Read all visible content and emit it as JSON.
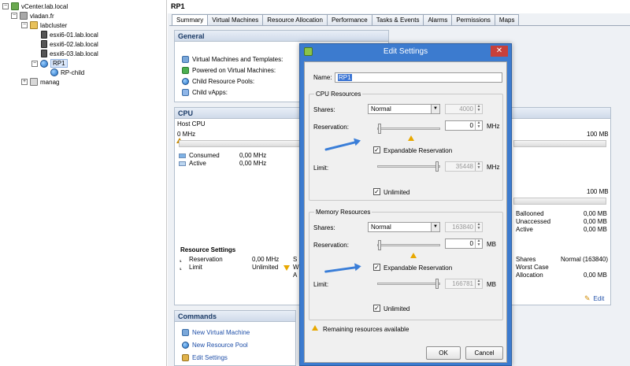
{
  "tree": {
    "root": "vCenter.lab.local",
    "datacenter": "vladan.fr",
    "cluster": "labcluster",
    "hosts": [
      "esxi6-01.lab.local",
      "esxi6-02.lab.local",
      "esxi6-03.lab.local"
    ],
    "resource_pool": "RP1",
    "child_pool": "RP-child",
    "other": "manag"
  },
  "right": {
    "title": "RP1",
    "tabs": [
      "Summary",
      "Virtual Machines",
      "Resource Allocation",
      "Performance",
      "Tasks & Events",
      "Alarms",
      "Permissions",
      "Maps"
    ],
    "general": {
      "header": "General",
      "rows": [
        "Virtual Machines and Templates:",
        "Powered on Virtual Machines:",
        "Child Resource Pools:",
        "Child vApps:"
      ]
    },
    "cpu": {
      "header": "CPU",
      "host_label": "Host CPU",
      "min": "0 MHz",
      "max1": "100 MB",
      "max2": "100 MB",
      "consumed_label": "Consumed",
      "consumed_value": "0,00 MHz",
      "active_label": "Active",
      "active_value": "0,00 MHz"
    },
    "memory_right": {
      "ballooned_label": "Ballooned",
      "ballooned_value": "0,00 MB",
      "unaccessed_label": "Unaccessed",
      "unaccessed_value": "0,00 MB",
      "active_label": "Active",
      "active_value": "0,00 MB",
      "shares_label": "Shares",
      "shares_value": "Normal (163840)",
      "worst_label": "Worst Case",
      "allocation_label": "Allocation",
      "allocation_value": "0,00 MB",
      "edit_label": "Edit"
    },
    "resource_settings": {
      "header": "Resource Settings",
      "reservation_label": "Reservation",
      "reservation_value": "0,00 MHz",
      "limit_label": "Limit",
      "limit_value": "Unlimited",
      "partial1": "S",
      "partial2": "W",
      "partial3": "A"
    },
    "commands": {
      "header": "Commands",
      "items": [
        "New Virtual Machine",
        "New Resource Pool",
        "Edit Settings"
      ]
    }
  },
  "dialog": {
    "title": "Edit Settings",
    "close": "✕",
    "name_label": "Name:",
    "name_value": "RP1",
    "cpu": {
      "group": "CPU Resources",
      "shares_label": "Shares:",
      "shares_value": "Normal",
      "shares_number": "4000",
      "reservation_label": "Reservation:",
      "reservation_value": "0",
      "reservation_unit": "MHz",
      "expandable_label": "Expandable Reservation",
      "expandable_checked": true,
      "limit_label": "Limit:",
      "limit_value": "35448",
      "limit_unit": "MHz",
      "unlimited_label": "Unlimited",
      "unlimited_checked": true
    },
    "memory": {
      "group": "Memory Resources",
      "shares_label": "Shares:",
      "shares_value": "Normal",
      "shares_number": "163840",
      "reservation_label": "Reservation:",
      "reservation_value": "0",
      "reservation_unit": "MB",
      "expandable_label": "Expandable Reservation",
      "expandable_checked": true,
      "limit_label": "Limit:",
      "limit_value": "166781",
      "limit_unit": "MB",
      "unlimited_label": "Unlimited",
      "unlimited_checked": true
    },
    "remaining": "Remaining resources available",
    "ok": "OK",
    "cancel": "Cancel"
  },
  "colors": {
    "accent": "#3c7bcf",
    "warning": "#e8a800",
    "link": "#1f4fa8"
  }
}
